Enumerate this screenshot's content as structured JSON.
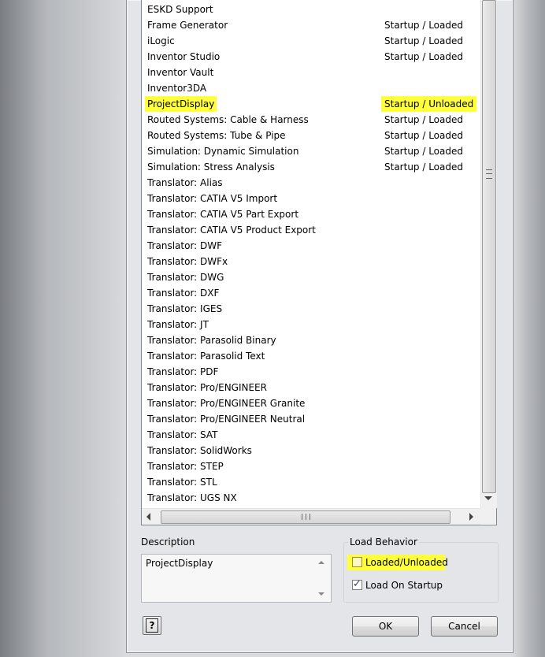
{
  "addins": [
    {
      "name": "ESKD Support",
      "status": ""
    },
    {
      "name": "Frame Generator",
      "status": "Startup / Loaded"
    },
    {
      "name": "iLogic",
      "status": "Startup / Loaded"
    },
    {
      "name": "Inventor Studio",
      "status": "Startup / Loaded"
    },
    {
      "name": "Inventor Vault",
      "status": ""
    },
    {
      "name": "Inventor3DA",
      "status": ""
    },
    {
      "name": "ProjectDisplay",
      "status": "Startup / Unloaded"
    },
    {
      "name": "Routed Systems: Cable & Harness",
      "status": "Startup / Loaded"
    },
    {
      "name": "Routed Systems: Tube & Pipe",
      "status": "Startup / Loaded"
    },
    {
      "name": "Simulation: Dynamic Simulation",
      "status": "Startup / Loaded"
    },
    {
      "name": "Simulation: Stress Analysis",
      "status": "Startup / Loaded"
    },
    {
      "name": "Translator: Alias",
      "status": ""
    },
    {
      "name": "Translator: CATIA V5 Import",
      "status": ""
    },
    {
      "name": "Translator: CATIA V5 Part Export",
      "status": ""
    },
    {
      "name": "Translator: CATIA V5 Product Export",
      "status": ""
    },
    {
      "name": "Translator: DWF",
      "status": ""
    },
    {
      "name": "Translator: DWFx",
      "status": ""
    },
    {
      "name": "Translator: DWG",
      "status": ""
    },
    {
      "name": "Translator: DXF",
      "status": ""
    },
    {
      "name": "Translator: IGES",
      "status": ""
    },
    {
      "name": "Translator: JT",
      "status": ""
    },
    {
      "name": "Translator: Parasolid Binary",
      "status": ""
    },
    {
      "name": "Translator: Parasolid Text",
      "status": ""
    },
    {
      "name": "Translator: PDF",
      "status": ""
    },
    {
      "name": "Translator: Pro/ENGINEER",
      "status": ""
    },
    {
      "name": "Translator: Pro/ENGINEER Granite",
      "status": ""
    },
    {
      "name": "Translator: Pro/ENGINEER Neutral",
      "status": ""
    },
    {
      "name": "Translator: SAT",
      "status": ""
    },
    {
      "name": "Translator: SolidWorks",
      "status": ""
    },
    {
      "name": "Translator: STEP",
      "status": ""
    },
    {
      "name": "Translator: STL",
      "status": ""
    },
    {
      "name": "Translator: UGS NX",
      "status": ""
    }
  ],
  "selected_index": 6,
  "highlight_color": "#ffff3c",
  "description": {
    "label": "Description",
    "text": "ProjectDisplay"
  },
  "load_behavior": {
    "title": "Load Behavior",
    "loaded_unloaded": {
      "label": "Loaded/Unloaded",
      "checked": false
    },
    "load_on_startup": {
      "label": "Load On Startup",
      "checked": true
    }
  },
  "buttons": {
    "help": "?",
    "ok": "OK",
    "cancel": "Cancel"
  }
}
